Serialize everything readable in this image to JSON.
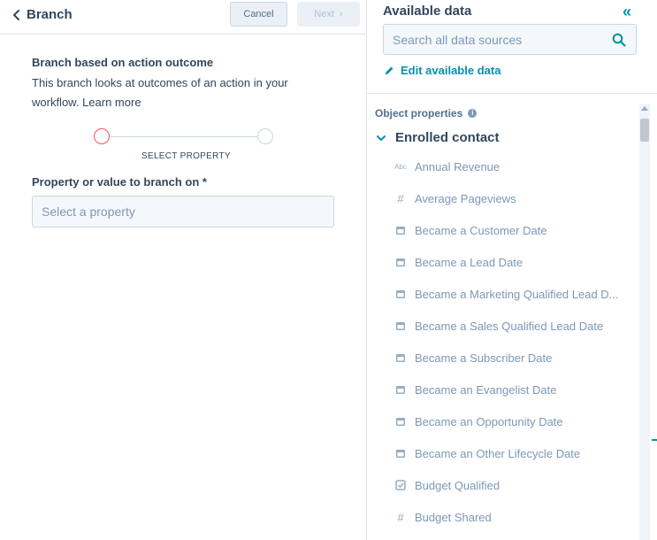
{
  "header": {
    "back_title": "Branch",
    "cancel_label": "Cancel",
    "next_label": "Next"
  },
  "branch": {
    "title": "Branch based on action outcome",
    "description": "This branch looks at outcomes of an action in your workflow. Learn more",
    "step_label": "SELECT PROPERTY",
    "field_label": "Property or value to branch on *",
    "select_placeholder": "Select a property"
  },
  "data_panel": {
    "title": "Available data",
    "search_placeholder": "Search all data sources",
    "edit_label": "Edit available data",
    "section_label": "Object properties",
    "group_label": "Enrolled contact",
    "items": [
      {
        "label": "Annual Revenue",
        "icon": "text-icon"
      },
      {
        "label": "Average Pageviews",
        "icon": "number-icon"
      },
      {
        "label": "Became a Customer Date",
        "icon": "calendar-icon"
      },
      {
        "label": "Became a Lead Date",
        "icon": "calendar-icon"
      },
      {
        "label": "Became a Marketing Qualified Lead D...",
        "icon": "calendar-icon"
      },
      {
        "label": "Became a Sales Qualified Lead Date",
        "icon": "calendar-icon"
      },
      {
        "label": "Became a Subscriber Date",
        "icon": "calendar-icon"
      },
      {
        "label": "Became an Evangelist Date",
        "icon": "calendar-icon"
      },
      {
        "label": "Became an Opportunity Date",
        "icon": "calendar-icon"
      },
      {
        "label": "Became an Other Lifecycle Date",
        "icon": "calendar-icon"
      },
      {
        "label": "Budget Qualified",
        "icon": "checkbox-icon"
      },
      {
        "label": "Budget Shared",
        "icon": "number-icon"
      }
    ]
  },
  "colors": {
    "accent": "#0091ae",
    "step_active": "#f2545b",
    "text": "#33475b",
    "muted": "#7c98b6"
  }
}
